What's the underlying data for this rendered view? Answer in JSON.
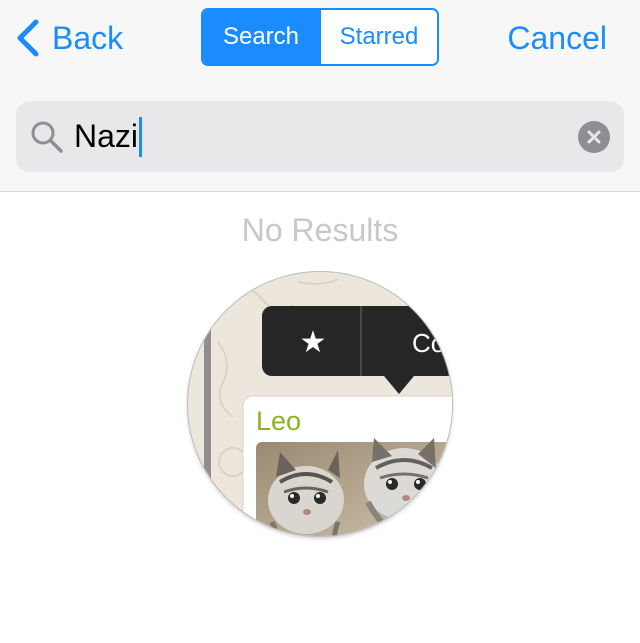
{
  "nav": {
    "back_label": "Back",
    "cancel_label": "Cancel",
    "segments": [
      "Search",
      "Starred"
    ]
  },
  "search": {
    "value": "Nazi"
  },
  "empty_state": {
    "message": "No Results"
  },
  "illustration": {
    "menu_star": "★",
    "menu_partial_label": "Co",
    "sender_name": "Leo"
  },
  "colors": {
    "accent": "#1a8cff",
    "sender_name": "#8cb21e"
  },
  "icons": [
    "chevron-left-icon",
    "search-icon",
    "clear-icon",
    "star-icon"
  ]
}
